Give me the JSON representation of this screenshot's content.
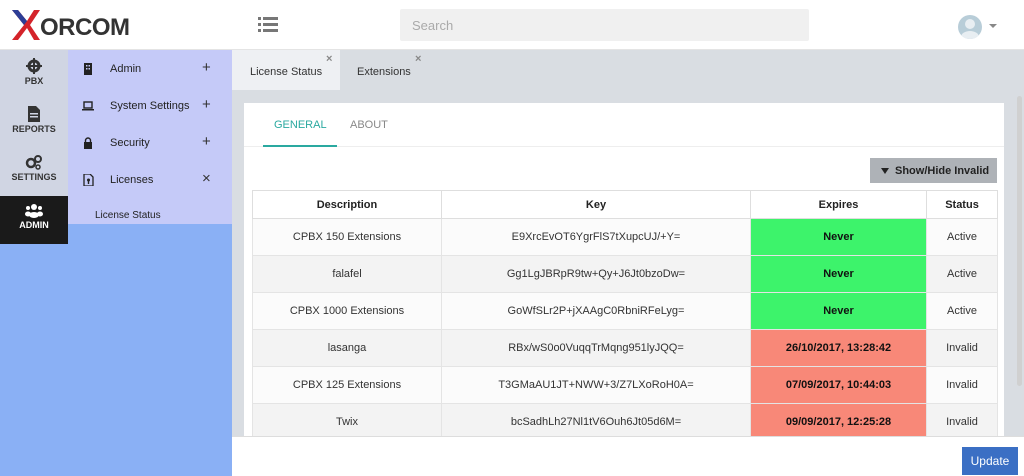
{
  "brand": {
    "name": "ORCOM",
    "accent": "#d4232a"
  },
  "search": {
    "placeholder": "Search"
  },
  "iconbar": {
    "items": [
      {
        "label": "PBX",
        "icon": "gear-icon",
        "active": false
      },
      {
        "label": "REPORTS",
        "icon": "document-icon",
        "active": false
      },
      {
        "label": "SETTINGS",
        "icon": "gears-icon",
        "active": false
      },
      {
        "label": "ADMIN",
        "icon": "users-icon",
        "active": true
      }
    ]
  },
  "submenu": {
    "items": [
      {
        "label": "Admin",
        "icon": "building-icon",
        "action": "+"
      },
      {
        "label": "System Settings",
        "icon": "laptop-icon",
        "action": "+"
      },
      {
        "label": "Security",
        "icon": "lock-icon",
        "action": "+"
      },
      {
        "label": "Licenses",
        "icon": "license-file-icon",
        "action": "×"
      }
    ],
    "subitem": "License Status"
  },
  "tabs": [
    {
      "label": "License Status",
      "close": "×"
    },
    {
      "label": "Extensions",
      "close": "×"
    }
  ],
  "card": {
    "tabs": [
      "GENERAL",
      "ABOUT"
    ],
    "toggle_label": "Show/Hide Invalid"
  },
  "table": {
    "headers": [
      "Description",
      "Key",
      "Expires",
      "Status"
    ],
    "rows": [
      {
        "description": "CPBX 150 Extensions",
        "key": "E9XrcEvOT6YgrFlS7tXupcUJ/+Y=",
        "expires": "Never",
        "status": "Active",
        "color": "#3df36b"
      },
      {
        "description": "falafel",
        "key": "Gg1LgJBRpR9tw+Qy+J6Jt0bzoDw=",
        "expires": "Never",
        "status": "Active",
        "color": "#3df36b"
      },
      {
        "description": "CPBX 1000 Extensions",
        "key": "GoWfSLr2P+jXAAgC0RbniRFeLyg=",
        "expires": "Never",
        "status": "Active",
        "color": "#3df36b"
      },
      {
        "description": "lasanga",
        "key": "RBx/wS0o0VuqqTrMqng951lyJQQ=",
        "expires": "26/10/2017, 13:28:42",
        "status": "Invalid",
        "color": "#f88878"
      },
      {
        "description": "CPBX 125 Extensions",
        "key": "T3GMaAU1JT+NWW+3/Z7LXoRoH0A=",
        "expires": "07/09/2017, 10:44:03",
        "status": "Invalid",
        "color": "#f88878"
      },
      {
        "description": "Twix",
        "key": "bcSadhLh27Nl1tV6Ouh6Jt05d6M=",
        "expires": "09/09/2017, 12:25:28",
        "status": "Invalid",
        "color": "#f88878"
      }
    ]
  },
  "footer": {
    "update_label": "Update"
  }
}
